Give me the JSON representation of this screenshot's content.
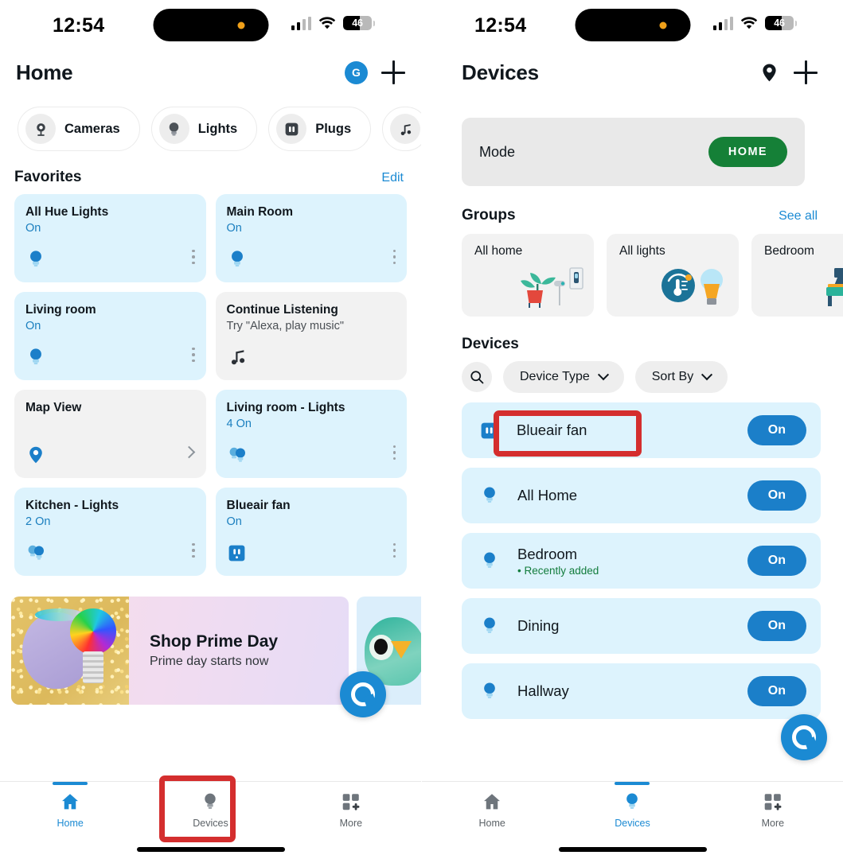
{
  "status_bar": {
    "time": "12:54",
    "battery_percent": "46",
    "icons": [
      "cellular-signal-icon",
      "wifi-icon",
      "battery-icon"
    ]
  },
  "left_screen": {
    "header": {
      "title": "Home",
      "avatar_initial": "G",
      "add_icon": "plus-icon"
    },
    "category_chips": [
      {
        "label": "Cameras",
        "icon": "camera-icon"
      },
      {
        "label": "Lights",
        "icon": "lightbulb-icon"
      },
      {
        "label": "Plugs",
        "icon": "plug-icon"
      },
      {
        "label": "",
        "icon": "music-note-icon"
      }
    ],
    "favorites": {
      "title": "Favorites",
      "edit_label": "Edit",
      "cards": [
        {
          "title": "All Hue Lights",
          "status": "On",
          "icon": "lightbulb-icon",
          "style": "blue",
          "action": "kebab"
        },
        {
          "title": "Main Room",
          "status": "On",
          "icon": "lightbulb-icon",
          "style": "blue",
          "action": "kebab"
        },
        {
          "title": "Living room",
          "status": "On",
          "icon": "lightbulb-icon",
          "style": "blue",
          "action": "kebab"
        },
        {
          "title": "Continue Listening",
          "status": "Try \"Alexa, play music\"",
          "icon": "music-note-icon",
          "style": "grey",
          "action": "none"
        },
        {
          "title": "Map View",
          "status": "",
          "icon": "map-pin-icon",
          "style": "grey",
          "action": "chevron"
        },
        {
          "title": "Living room - Lights",
          "status": "4 On",
          "icon": "multi-lightbulb-icon",
          "style": "blue",
          "action": "kebab"
        },
        {
          "title": "Kitchen - Lights",
          "status": "2 On",
          "icon": "multi-lightbulb-icon",
          "style": "blue",
          "action": "kebab"
        },
        {
          "title": "Blueair fan",
          "status": "On",
          "icon": "outlet-icon",
          "style": "blue",
          "action": "kebab"
        }
      ]
    },
    "promo": {
      "headline": "Shop Prime Day",
      "subline": "Prime day starts now",
      "art": "echo-speaker-and-rgb-bulb",
      "second_card_art": "owl-figure"
    },
    "alexa_button": "alexa-icon",
    "bottom_nav": {
      "items": [
        {
          "label": "Home",
          "icon": "home-icon",
          "active": true
        },
        {
          "label": "Devices",
          "icon": "lightbulb-icon",
          "active": false
        },
        {
          "label": "More",
          "icon": "grid-plus-icon",
          "active": false
        }
      ]
    },
    "highlight": "devices-tab-highlight"
  },
  "right_screen": {
    "header": {
      "title": "Devices",
      "location_icon": "map-pin-icon",
      "add_icon": "plus-icon"
    },
    "mode": {
      "label": "Mode",
      "value": "HOME"
    },
    "groups": {
      "title": "Groups",
      "see_all_label": "See all",
      "cards": [
        {
          "title": "All home",
          "art": "plant-switch-illustration"
        },
        {
          "title": "All lights",
          "art": "thermostat-bulb-illustration"
        },
        {
          "title": "Bedroom",
          "art": "bed-lamp-illustration"
        }
      ]
    },
    "devices": {
      "title": "Devices",
      "search_icon": "search-icon",
      "filters": [
        {
          "label": "Device Type",
          "icon": "chevron-down-icon",
          "highlighted": true
        },
        {
          "label": "Sort By",
          "icon": "chevron-down-icon",
          "highlighted": false
        }
      ],
      "rows": [
        {
          "name": "Blueair fan",
          "sub": "",
          "icon": "outlet-icon",
          "toggle": "On"
        },
        {
          "name": "All Home",
          "sub": "",
          "icon": "lightbulb-icon",
          "toggle": "On"
        },
        {
          "name": "Bedroom",
          "sub": "Recently added",
          "icon": "lightbulb-icon",
          "toggle": "On"
        },
        {
          "name": "Dining",
          "sub": "",
          "icon": "lightbulb-icon",
          "toggle": "On"
        },
        {
          "name": "Hallway",
          "sub": "",
          "icon": "lightbulb-icon",
          "toggle": "On"
        }
      ]
    },
    "alexa_button": "alexa-icon",
    "bottom_nav": {
      "items": [
        {
          "label": "Home",
          "icon": "home-icon",
          "active": false
        },
        {
          "label": "Devices",
          "icon": "lightbulb-icon",
          "active": true
        },
        {
          "label": "More",
          "icon": "grid-plus-icon",
          "active": false
        }
      ]
    },
    "highlight": "device-type-filter-highlight"
  },
  "colors": {
    "accent_blue": "#1b8ad3",
    "card_blue": "#ddf3fd",
    "card_grey": "#f2f2f2",
    "mode_green": "#158037",
    "toggle_blue": "#1b7fc9",
    "highlight_red": "#d42e2e",
    "recently_added_green": "#127c3c"
  }
}
